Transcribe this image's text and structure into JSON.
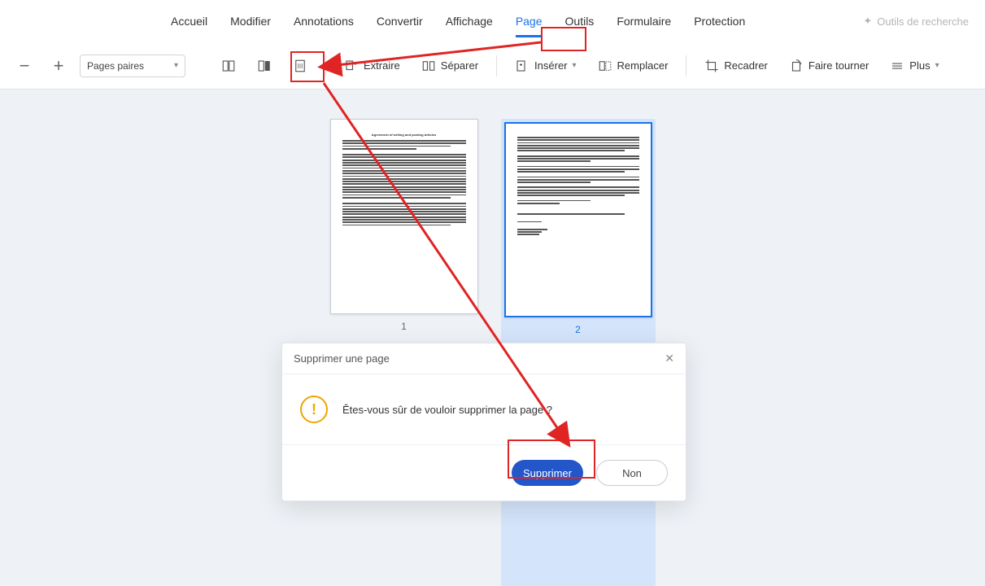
{
  "tabs": {
    "home": "Accueil",
    "edit": "Modifier",
    "annot": "Annotations",
    "convert": "Convertir",
    "view": "Affichage",
    "page": "Page",
    "tools": "Outils",
    "form": "Formulaire",
    "protect": "Protection"
  },
  "search_tools": "Outils de recherche",
  "select": {
    "label": "Pages paires"
  },
  "toolbar": {
    "extract": "Extraire",
    "separate": "Séparer",
    "insert": "Insérer",
    "replace": "Remplacer",
    "crop": "Recadrer",
    "rotate": "Faire tourner",
    "more": "Plus"
  },
  "pages": {
    "p1": "1",
    "p2": "2"
  },
  "dialog": {
    "title": "Supprimer une page",
    "message": "Êtes-vous sûr de vouloir supprimer la page ?",
    "confirm": "Supprimer",
    "cancel": "Non"
  }
}
